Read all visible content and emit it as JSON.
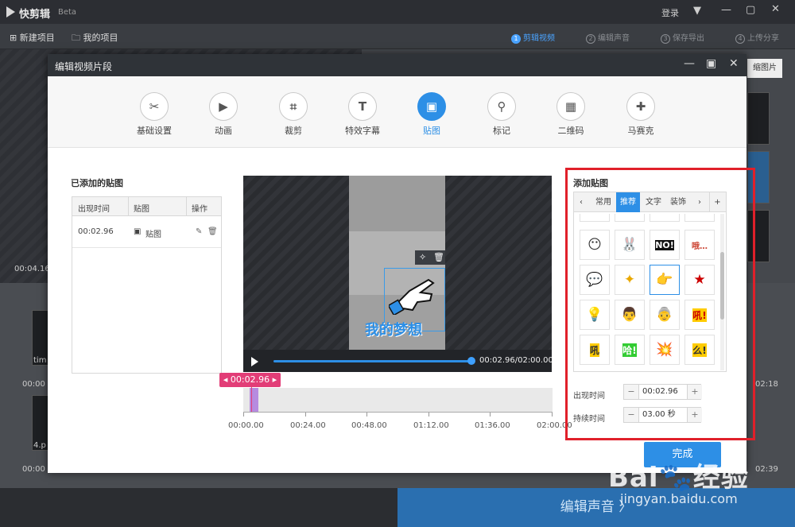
{
  "app": {
    "title": "快剪辑",
    "beta": "Beta",
    "login": "登录"
  },
  "toolbar": {
    "new_project": "新建项目",
    "my_projects": "我的项目"
  },
  "steps": [
    {
      "num": "1",
      "label": "剪辑视频"
    },
    {
      "num": "2",
      "label": "编辑声音"
    },
    {
      "num": "3",
      "label": "保存导出"
    },
    {
      "num": "4",
      "label": "上传分享"
    }
  ],
  "background": {
    "thumb_btn": "缩图片",
    "time_left": "00:04.16/",
    "times": [
      "00:00",
      "02:18",
      "02:39",
      "00:00",
      "02:18"
    ],
    "labels": [
      "tim",
      "4.p"
    ],
    "edit_audio": "编辑声音 〉"
  },
  "modal": {
    "title": "编辑视频片段",
    "tools": [
      {
        "icon": "✂",
        "label": "基础设置"
      },
      {
        "icon": "▶",
        "label": "动画"
      },
      {
        "icon": "⌗",
        "label": "裁剪"
      },
      {
        "icon": "T",
        "label": "特效字幕"
      },
      {
        "icon": "▣",
        "label": "贴图"
      },
      {
        "icon": "⚲",
        "label": "标记"
      },
      {
        "icon": "▦",
        "label": "二维码"
      },
      {
        "icon": "✚",
        "label": "马赛克"
      }
    ],
    "active_tool": "贴图"
  },
  "list": {
    "title": "已添加的贴图",
    "headers": [
      "出现时间",
      "贴图",
      "操作"
    ],
    "rows": [
      {
        "time": "00:02.96",
        "name": "贴图"
      }
    ]
  },
  "video": {
    "sticker_text": "我的梦想",
    "time": "00:02.96/02:00.00",
    "progress": 0.98
  },
  "timeline": {
    "tag": "00:02.96",
    "labels": [
      "00:00.00",
      "00:24.00",
      "00:48.00",
      "01:12.00",
      "01:36.00",
      "02:00.00"
    ]
  },
  "panel": {
    "title": "添加贴图",
    "tabs": [
      "常用",
      "推荐",
      "文字",
      "装饰"
    ],
    "active_tab": "推荐",
    "stickers": [
      "😶",
      "🐰",
      "NO!",
      "哦…",
      "💬",
      "✦",
      "👉",
      "★",
      "💡",
      "👨",
      "👵",
      "吼!",
      "吼",
      "哈!",
      "💥",
      "么!"
    ],
    "appear_label": "出现时间",
    "appear_value": "00:02.96",
    "duration_label": "持续时间",
    "duration_value": "03.00 秒"
  },
  "done_button": "完成",
  "watermark": {
    "logo": "Bai🐾经验",
    "url": "jingyan.baidu.com"
  },
  "colors": {
    "accent": "#2d8fe6",
    "highlight": "#e0202a",
    "marker": "#e23d77"
  }
}
